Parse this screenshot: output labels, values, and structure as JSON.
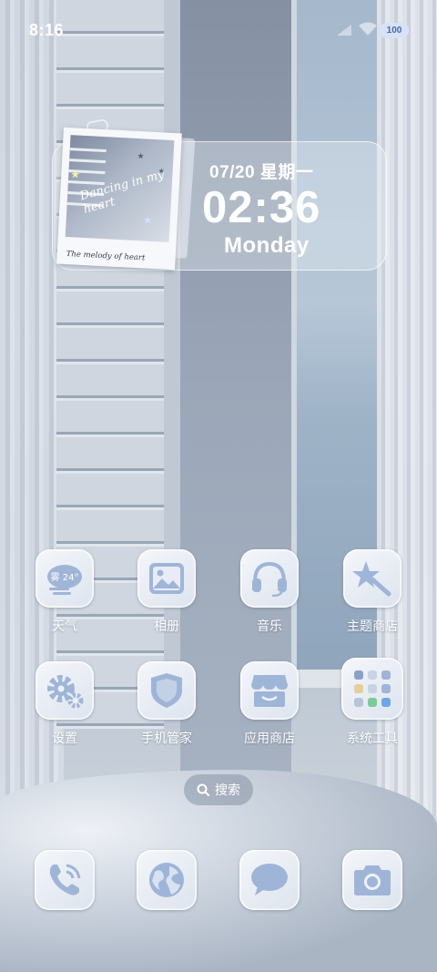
{
  "status_bar": {
    "time": "8:16",
    "battery": "100"
  },
  "widget": {
    "date": "07/20  星期一",
    "time": "02:36",
    "day": "Monday",
    "polaroid_script": "Dancing in my heart",
    "polaroid_caption": "The melody of heart"
  },
  "apps": [
    {
      "label": "天气",
      "icon": "weather-icon",
      "weather_text": "雾 24°"
    },
    {
      "label": "相册",
      "icon": "gallery-icon"
    },
    {
      "label": "音乐",
      "icon": "headphones-icon"
    },
    {
      "label": "主题商店",
      "icon": "theme-star-icon"
    },
    {
      "label": "设置",
      "icon": "gear-icon"
    },
    {
      "label": "手机管家",
      "icon": "shield-icon"
    },
    {
      "label": "应用商店",
      "icon": "store-icon"
    },
    {
      "label": "系统工具",
      "icon": "folder-grid-icon"
    }
  ],
  "search": {
    "label": "搜索"
  },
  "dock": [
    {
      "icon": "phone-icon"
    },
    {
      "icon": "browser-globe-icon"
    },
    {
      "icon": "message-icon"
    },
    {
      "icon": "camera-icon"
    }
  ],
  "colors": {
    "icon_blue": "#9fb5d8",
    "icon_bg": "#eef1f6",
    "text": "#ffffff"
  }
}
